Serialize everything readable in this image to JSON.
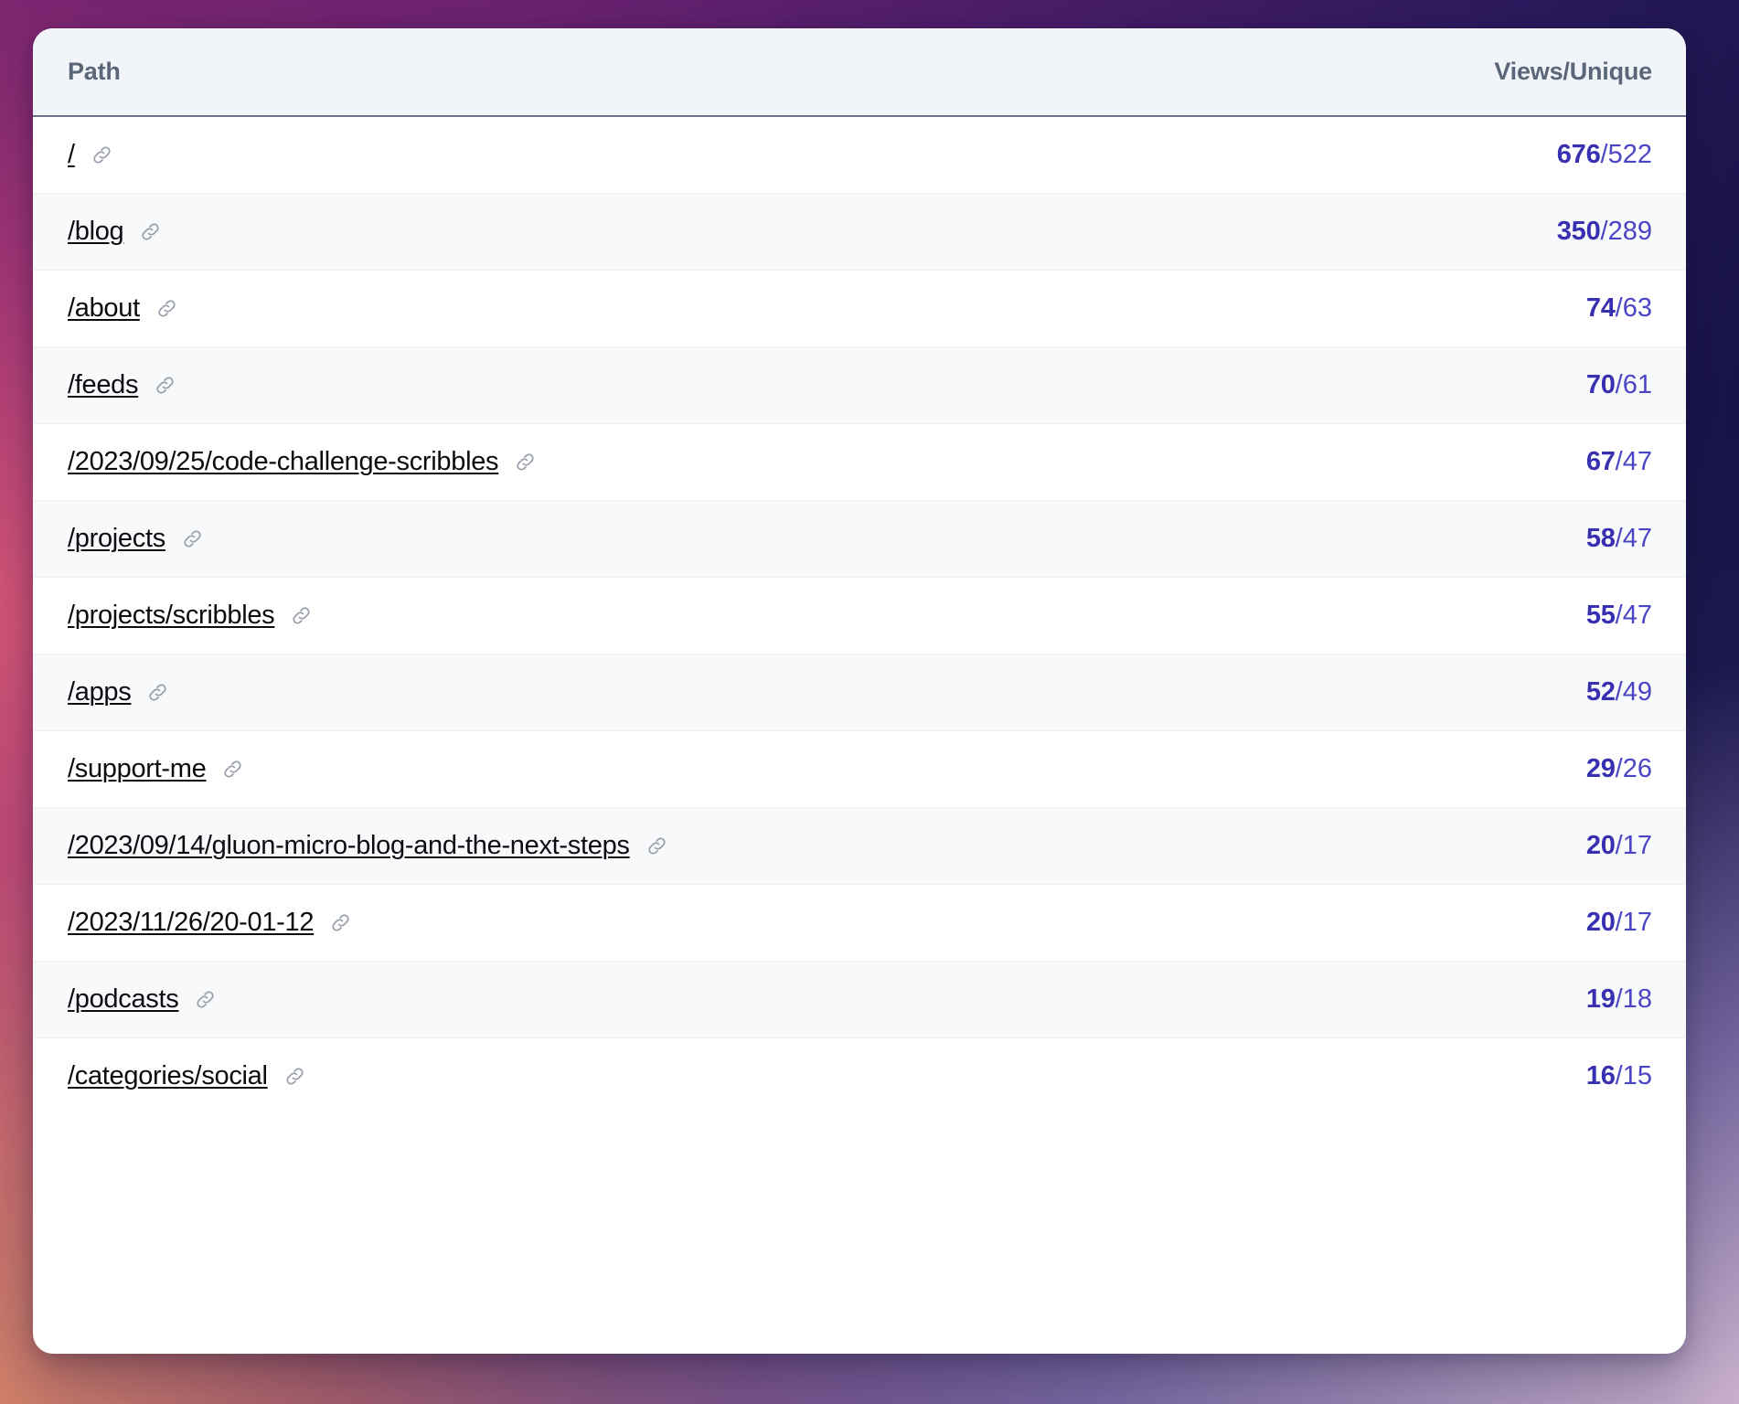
{
  "table": {
    "columns": {
      "path": "Path",
      "views_unique": "Views/Unique"
    },
    "link_icon_name": "link-icon",
    "rows": [
      {
        "path": "/",
        "views": "676",
        "separator": "/",
        "unique": "522"
      },
      {
        "path": "/blog",
        "views": "350",
        "separator": "/",
        "unique": "289"
      },
      {
        "path": "/about",
        "views": "74",
        "separator": "/",
        "unique": "63"
      },
      {
        "path": "/feeds",
        "views": "70",
        "separator": "/",
        "unique": "61"
      },
      {
        "path": "/2023/09/25/code-challenge-scribbles",
        "views": "67",
        "separator": "/",
        "unique": "47"
      },
      {
        "path": "/projects",
        "views": "58",
        "separator": "/",
        "unique": "47"
      },
      {
        "path": "/projects/scribbles",
        "views": "55",
        "separator": "/",
        "unique": "47"
      },
      {
        "path": "/apps",
        "views": "52",
        "separator": "/",
        "unique": "49"
      },
      {
        "path": "/support-me",
        "views": "29",
        "separator": "/",
        "unique": "26"
      },
      {
        "path": "/2023/09/14/gluon-micro-blog-and-the-next-steps",
        "views": "20",
        "separator": "/",
        "unique": "17"
      },
      {
        "path": "/2023/11/26/20-01-12",
        "views": "20",
        "separator": "/",
        "unique": "17"
      },
      {
        "path": "/podcasts",
        "views": "19",
        "separator": "/",
        "unique": "18"
      },
      {
        "path": "/categories/social",
        "views": "16",
        "separator": "/",
        "unique": "15"
      }
    ]
  },
  "colors": {
    "views_accent": "#3730b0",
    "unique_accent": "#4a45c4",
    "header_text": "#5c6679",
    "path_text": "#0a0c10"
  }
}
